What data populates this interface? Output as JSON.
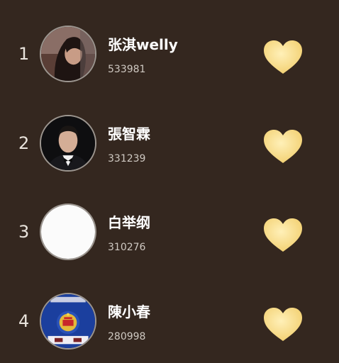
{
  "ranking": {
    "entries": [
      {
        "rank": "1",
        "name": "张淇welly",
        "score": "533981",
        "avatar": "portrait-photo",
        "like_icon": "heart-icon"
      },
      {
        "rank": "2",
        "name": "張智霖",
        "score": "331239",
        "avatar": "portrait-photo-tuxedo",
        "like_icon": "heart-icon"
      },
      {
        "rank": "3",
        "name": "白举纲",
        "score": "310276",
        "avatar": "blank-avatar",
        "like_icon": "heart-icon"
      },
      {
        "rank": "4",
        "name": "陳小春",
        "score": "280998",
        "avatar": "emblem-avatar",
        "like_icon": "heart-icon"
      }
    ]
  },
  "colors": {
    "background": "#34271f",
    "heart": "#f5d98a",
    "name_text": "#ffffff",
    "score_text": "#cfc9c2",
    "rank_text": "#e9e3dc"
  }
}
